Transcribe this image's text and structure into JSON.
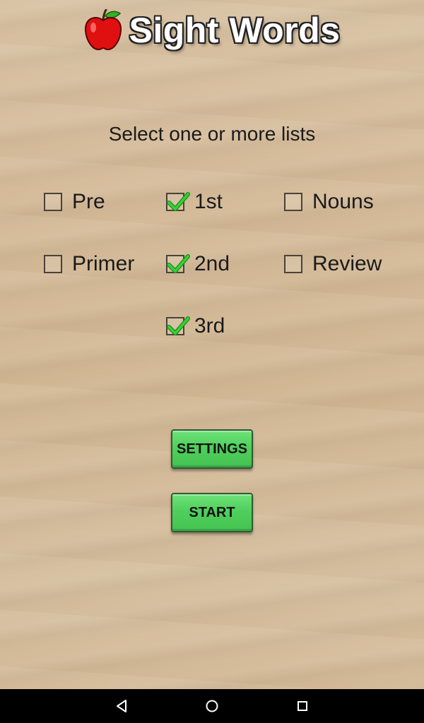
{
  "app": {
    "title": "Sight Words",
    "instruction": "Select one or more lists"
  },
  "lists": [
    {
      "label": "Pre",
      "checked": false
    },
    {
      "label": "1st",
      "checked": true
    },
    {
      "label": "Nouns",
      "checked": false
    },
    {
      "label": "Primer",
      "checked": false
    },
    {
      "label": "2nd",
      "checked": true
    },
    {
      "label": "Review",
      "checked": false
    },
    {
      "label": "3rd",
      "checked": true
    }
  ],
  "buttons": {
    "settings": "SETTINGS",
    "start": "START"
  },
  "icons": {
    "logo": "apple-icon",
    "check": "checkmark-icon",
    "nav_back": "back-icon",
    "nav_home": "home-icon",
    "nav_recent": "recents-icon"
  },
  "colors": {
    "button_green": "#4fd05c",
    "check_green": "#27c227",
    "apple_red": "#e01010"
  }
}
